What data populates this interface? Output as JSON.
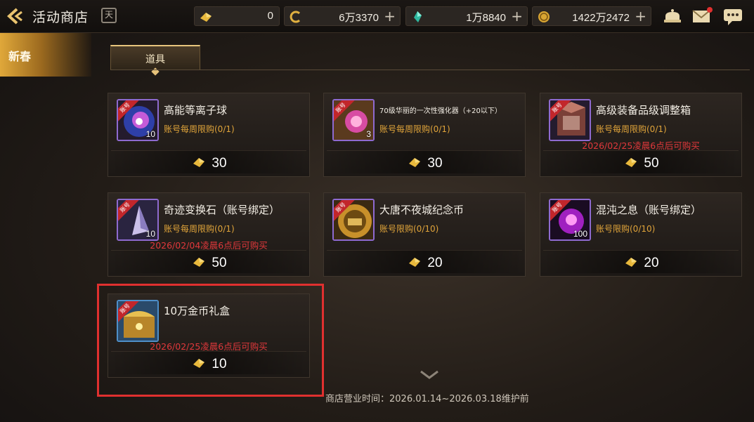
{
  "header": {
    "title": "活动商店",
    "calendar_icon_text": "天",
    "currencies": [
      {
        "icon": "gold-ingot-icon",
        "value": "0"
      },
      {
        "icon": "c-coin-icon",
        "value": "6万3370"
      },
      {
        "icon": "green-crystal-icon",
        "value": "1万8840"
      },
      {
        "icon": "gold-coin-icon",
        "value": "1422万2472"
      }
    ],
    "icons": [
      "shop-bag-icon",
      "mail-icon",
      "chat-icon"
    ]
  },
  "sidebar": {
    "items": [
      {
        "label": "新春",
        "active": true
      }
    ]
  },
  "tabs": [
    {
      "label": "道具",
      "active": true
    }
  ],
  "items": [
    {
      "name": "高能等离子球",
      "limit": "账号每周限购(0/1)",
      "notice": "",
      "price": "30",
      "qty": "10",
      "tag": "账号",
      "frame": "purple"
    },
    {
      "name": "70级华丽的一次性强化器（+20以下）",
      "limit": "账号每周限购(0/1)",
      "notice": "",
      "price": "30",
      "qty": "3",
      "tag": "账号",
      "frame": "purple"
    },
    {
      "name": "高级装备品级调整箱",
      "limit": "账号每周限购(0/1)",
      "notice": "2026/02/25凌晨6点后可购买",
      "price": "50",
      "qty": "",
      "tag": "账号",
      "frame": "purple"
    },
    {
      "name": "奇迹变换石（账号绑定）",
      "limit": "账号每周限购(0/1)",
      "notice": "2026/02/04凌晨6点后可购买",
      "price": "50",
      "qty": "10",
      "tag": "账号",
      "frame": "purple"
    },
    {
      "name": "大唐不夜城纪念币",
      "limit": "账号限购(0/10)",
      "notice": "",
      "price": "20",
      "qty": "",
      "tag": "账号",
      "frame": "purple"
    },
    {
      "name": "混沌之息（账号绑定）",
      "limit": "账号限购(0/10)",
      "notice": "",
      "price": "20",
      "qty": "100",
      "tag": "账号",
      "frame": "purple"
    },
    {
      "name": "10万金币礼盒",
      "limit": "",
      "notice": "2026/02/25凌晨6点后可购买",
      "price": "10",
      "qty": "",
      "tag": "账号",
      "frame": "blue"
    }
  ],
  "footer": {
    "text": "商店营业时间：2026.01.14~2026.03.18维护前"
  },
  "colors": {
    "accent_gold": "#e0a43a",
    "notice_red": "#e1383b",
    "highlight_red": "#e0302f"
  }
}
